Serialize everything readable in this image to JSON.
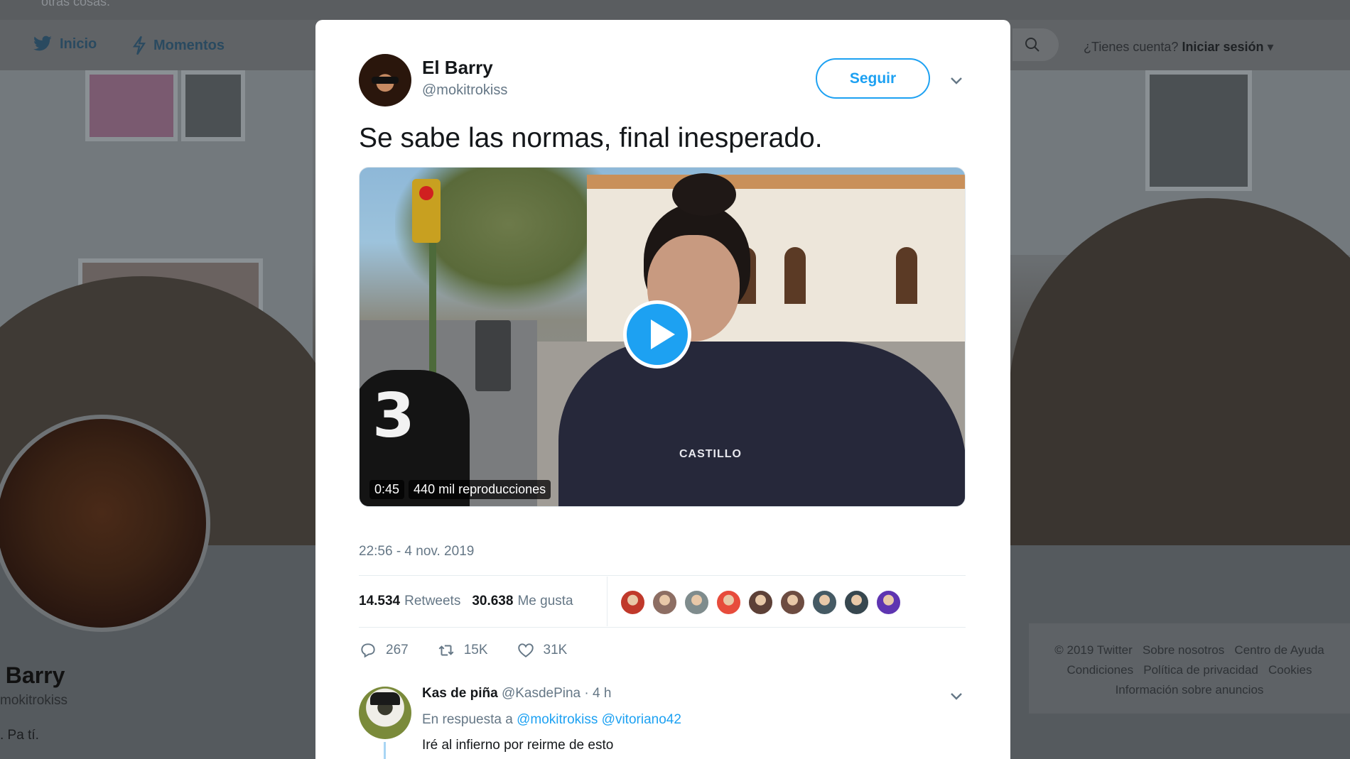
{
  "background": {
    "top_text": "otras cosas.",
    "nav": {
      "home_label": "Inicio",
      "moments_label": "Momentos",
      "login_prompt": "¿Tienes cuenta?",
      "login_label": "Iniciar sesión"
    },
    "profile": {
      "name": "l Barry",
      "handle": "mokitrokiss",
      "bio": ". Pa tí."
    },
    "footer_links": [
      "© 2019 Twitter",
      "Sobre nosotros",
      "Centro de Ayuda",
      "Condiciones",
      "Política de privacidad",
      "Cookies",
      "Información sobre anuncios"
    ]
  },
  "tweet": {
    "author_name": "El Barry",
    "author_handle": "@mokitrokiss",
    "follow_label": "Seguir",
    "text": "Se sabe las normas, final inesperado.",
    "video": {
      "duration": "0:45",
      "views": "440 mil reproducciones",
      "mic_number": "3",
      "shirt_logo": "CASTILLO"
    },
    "timestamp": "22:56 - 4 nov. 2019",
    "retweets_count": "14.534",
    "retweets_label": "Retweets",
    "likes_count": "30.638",
    "likes_label": "Me gusta",
    "liker_colors": [
      "#c0392b",
      "#8d6e63",
      "#7f8c8d",
      "#e74c3c",
      "#5d4037",
      "#6d4c41",
      "#455a64",
      "#37474f",
      "#5e35b1"
    ],
    "actions": {
      "replies": "267",
      "retweets": "15K",
      "likes": "31K"
    }
  },
  "reply": {
    "name": "Kas de piña",
    "handle": "@KasdePina",
    "time": "· 4 h",
    "in_reply_label": "En respuesta a",
    "mention_1": "@mokitrokiss",
    "mention_2": "@vitoriano42",
    "text": "Iré al infierno por reirme de esto"
  },
  "colors": {
    "accent": "#1da1f2",
    "text_primary": "#14171a",
    "text_secondary": "#657786"
  }
}
